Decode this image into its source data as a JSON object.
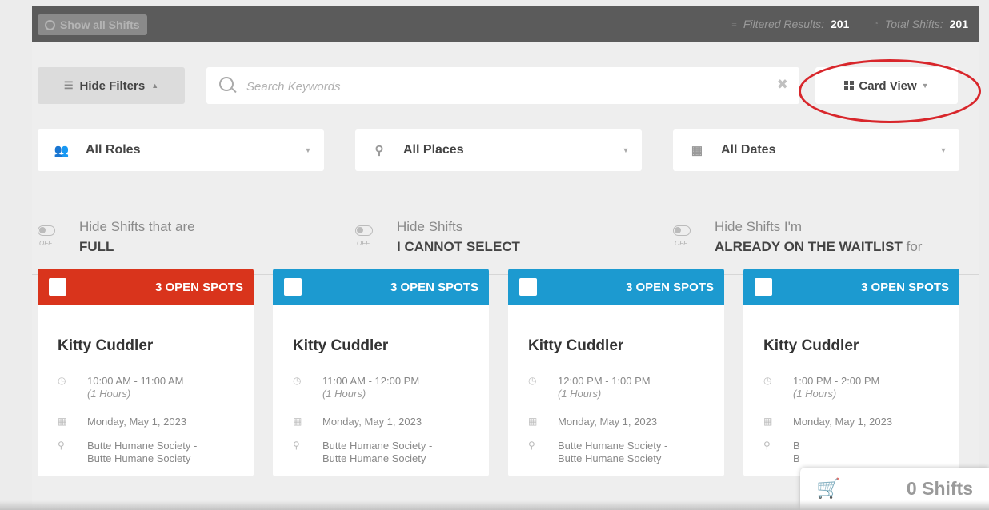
{
  "topbar": {
    "show_all_label": "Show all Shifts",
    "filtered_label": "Filtered Results:",
    "filtered_value": "201",
    "total_label": "Total Shifts:",
    "total_value": "201"
  },
  "controls": {
    "hide_filters_label": "Hide Filters",
    "search_placeholder": "Search Keywords",
    "card_view_label": "Card View"
  },
  "filters": {
    "roles": "All Roles",
    "places": "All Places",
    "dates": "All Dates"
  },
  "toggles": [
    {
      "line1": "Hide Shifts that are",
      "line2": "FULL",
      "tail": "",
      "state": "OFF"
    },
    {
      "line1": "Hide Shifts",
      "line2": "I CANNOT SELECT",
      "tail": "",
      "state": "OFF"
    },
    {
      "line1": "Hide Shifts I'm",
      "line2": "ALREADY ON THE WAITLIST",
      "tail": "for",
      "state": "OFF"
    }
  ],
  "cards": [
    {
      "spots": "3 OPEN SPOTS",
      "color": "#d9341c",
      "title": "Kitty Cuddler",
      "time": "10:00 AM - 11:00 AM",
      "duration": "(1 Hours)",
      "date": "Monday, May 1, 2023",
      "place1": "Butte Humane Society -",
      "place2": "Butte Humane Society"
    },
    {
      "spots": "3 OPEN SPOTS",
      "color": "#1c9ad0",
      "title": "Kitty Cuddler",
      "time": "11:00 AM - 12:00 PM",
      "duration": "(1 Hours)",
      "date": "Monday, May 1, 2023",
      "place1": "Butte Humane Society -",
      "place2": "Butte Humane Society"
    },
    {
      "spots": "3 OPEN SPOTS",
      "color": "#1c9ad0",
      "title": "Kitty Cuddler",
      "time": "12:00 PM - 1:00 PM",
      "duration": "(1 Hours)",
      "date": "Monday, May 1, 2023",
      "place1": "Butte Humane Society -",
      "place2": "Butte Humane Society"
    },
    {
      "spots": "3 OPEN SPOTS",
      "color": "#1c9ad0",
      "title": "Kitty Cuddler",
      "time": "1:00 PM - 2:00 PM",
      "duration": "(1 Hours)",
      "date": "Monday, May 1, 2023",
      "place1": "B",
      "place2": "B"
    }
  ],
  "cart": {
    "label": "0 Shifts"
  },
  "icons": {
    "roles": "users-icon",
    "places": "map-marker-icon",
    "dates": "calendar-icon",
    "cart": "shopping-cart-icon"
  }
}
